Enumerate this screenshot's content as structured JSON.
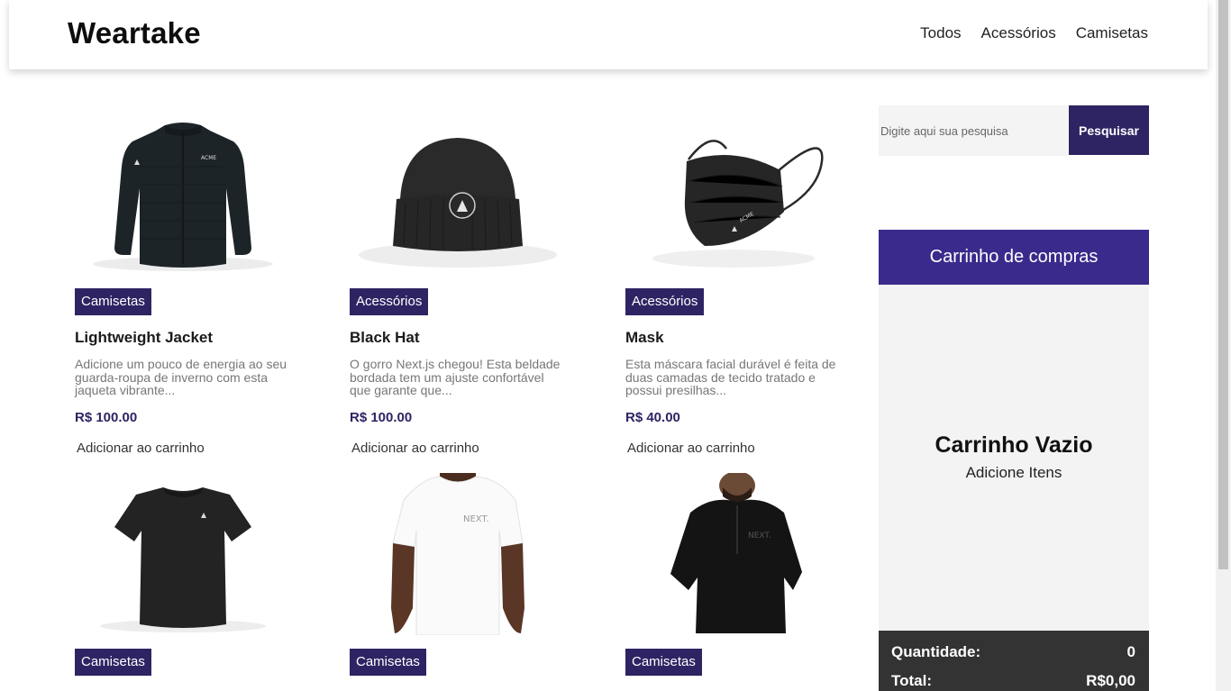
{
  "header": {
    "brand": "Weartake",
    "nav": [
      "Todos",
      "Acessórios",
      "Camisetas"
    ]
  },
  "search": {
    "placeholder": "Digite aqui sua pesquisa",
    "button_label": "Pesquisar"
  },
  "products": [
    {
      "image": "jacket-image",
      "category": "Camisetas",
      "name": "Lightweight Jacket",
      "description": "Adicione um pouco de energia ao seu guarda-roupa de inverno com esta jaqueta vibrante...",
      "price": "R$ 100.00",
      "add_label": "Adicionar ao carrinho"
    },
    {
      "image": "beanie-image",
      "category": "Acessórios",
      "name": "Black Hat",
      "description": "O gorro Next.js chegou! Esta beldade bordada tem um ajuste confortável que garante que...",
      "price": "R$ 100.00",
      "add_label": "Adicionar ao carrinho"
    },
    {
      "image": "mask-image",
      "category": "Acessórios",
      "name": "Mask",
      "description": "Esta máscara facial durável é feita de duas camadas de tecido tratado e possui presilhas...",
      "price": "R$ 40.00",
      "add_label": "Adicionar ao carrinho"
    },
    {
      "image": "black-tshirt-image",
      "category": "Camisetas"
    },
    {
      "image": "white-tshirt-image",
      "category": "Camisetas"
    },
    {
      "image": "black-windbreaker-image",
      "category": "Camisetas"
    }
  ],
  "cart": {
    "title": "Carrinho de compras",
    "empty_title": "Carrinho Vazio",
    "empty_subtitle": "Adicione Itens",
    "quantity_label": "Quantidade:",
    "quantity_value": "0",
    "total_label": "Total:",
    "total_value": "R$0,00"
  },
  "colors": {
    "accent": "#2e2463",
    "cart_header": "#3a2a8c",
    "cart_footer": "#333333"
  }
}
